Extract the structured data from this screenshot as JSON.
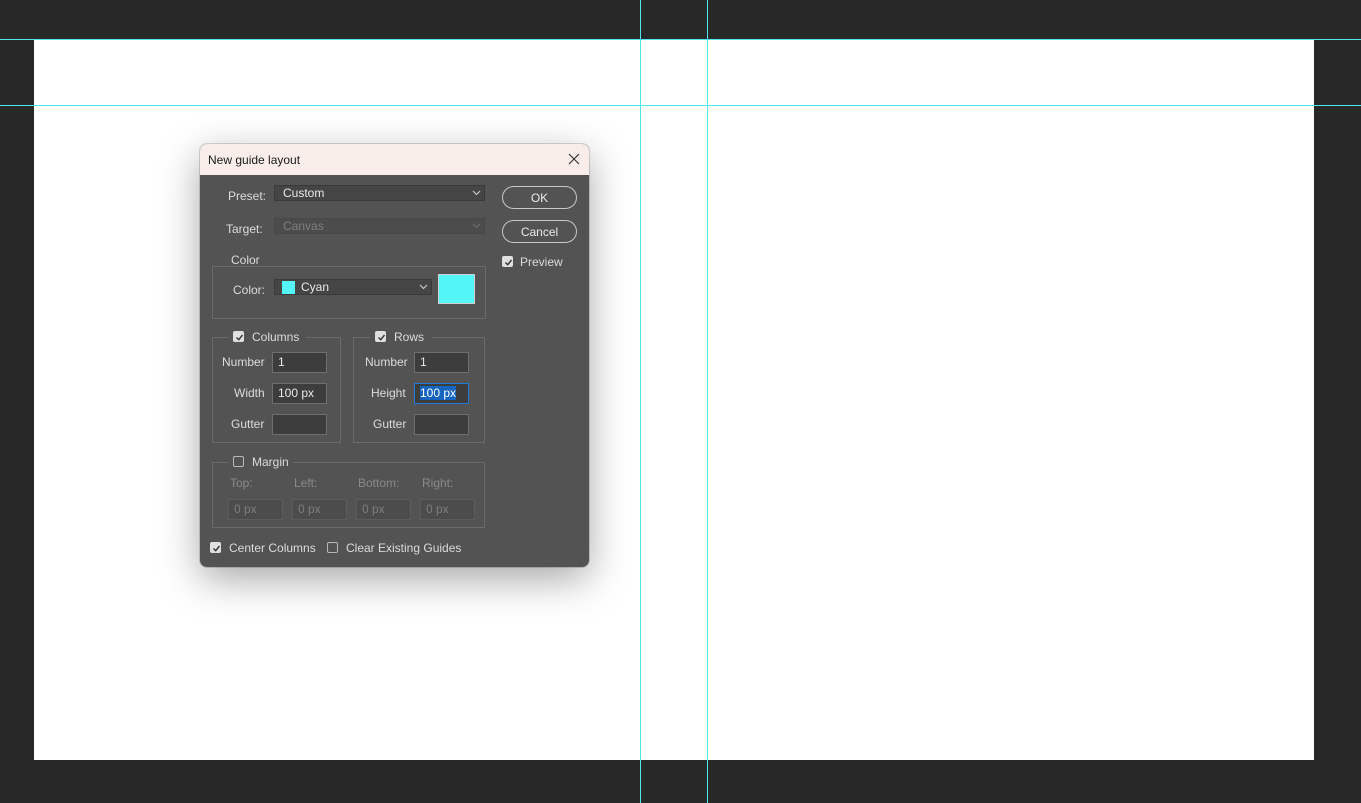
{
  "dialog": {
    "title": "New guide layout",
    "preset_label": "Preset:",
    "preset_value": "Custom",
    "target_label": "Target:",
    "target_value": "Canvas",
    "ok_label": "OK",
    "cancel_label": "Cancel",
    "preview_label": "Preview",
    "preview_checked": true,
    "color_group": {
      "legend": "Color",
      "label": "Color:",
      "value": "Cyan",
      "swatch_color": "#54f5f7"
    },
    "columns": {
      "legend": "Columns",
      "checked": true,
      "number_label": "Number",
      "number_value": "1",
      "width_label": "Width",
      "width_value": "100 px",
      "gutter_label": "Gutter",
      "gutter_value": ""
    },
    "rows": {
      "legend": "Rows",
      "checked": true,
      "number_label": "Number",
      "number_value": "1",
      "height_label": "Height",
      "height_value": "100 px",
      "gutter_label": "Gutter",
      "gutter_value": ""
    },
    "margin": {
      "legend": "Margin",
      "checked": false,
      "top_label": "Top:",
      "top_value": "0 px",
      "left_label": "Left:",
      "left_value": "0 px",
      "bottom_label": "Bottom:",
      "bottom_value": "0 px",
      "right_label": "Right:",
      "right_value": "0 px"
    },
    "center_columns_label": "Center Columns",
    "center_columns_checked": true,
    "clear_guides_label": "Clear Existing Guides",
    "clear_guides_checked": false
  },
  "colors": {
    "guide": "#4ce9ef",
    "workspace": "#282828",
    "dialog_bg": "#535353",
    "titlebar_bg": "#f8ede9",
    "selection": "#1565c0"
  }
}
